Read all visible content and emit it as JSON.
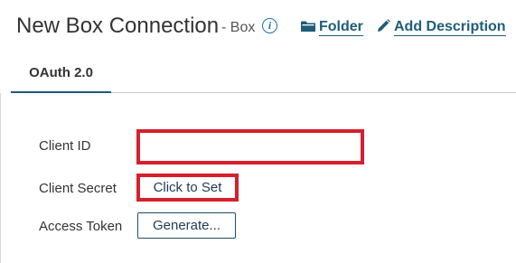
{
  "header": {
    "title": "New Box Connection",
    "subtitle": "- Box",
    "info_icon": "info-icon",
    "folder_link": "Folder",
    "folder_icon": "folder-icon",
    "add_description_link": "Add Description",
    "add_description_icon": "pencil-icon",
    "accent_color": "#1e5d78"
  },
  "tabs": [
    {
      "label": "OAuth 2.0",
      "active": true
    }
  ],
  "form": {
    "client_id": {
      "label": "Client ID",
      "value": ""
    },
    "client_secret": {
      "label": "Client Secret",
      "button_label": "Click to Set"
    },
    "access_token": {
      "label": "Access Token",
      "button_label": "Generate..."
    },
    "highlight_color": "#d6202c"
  }
}
